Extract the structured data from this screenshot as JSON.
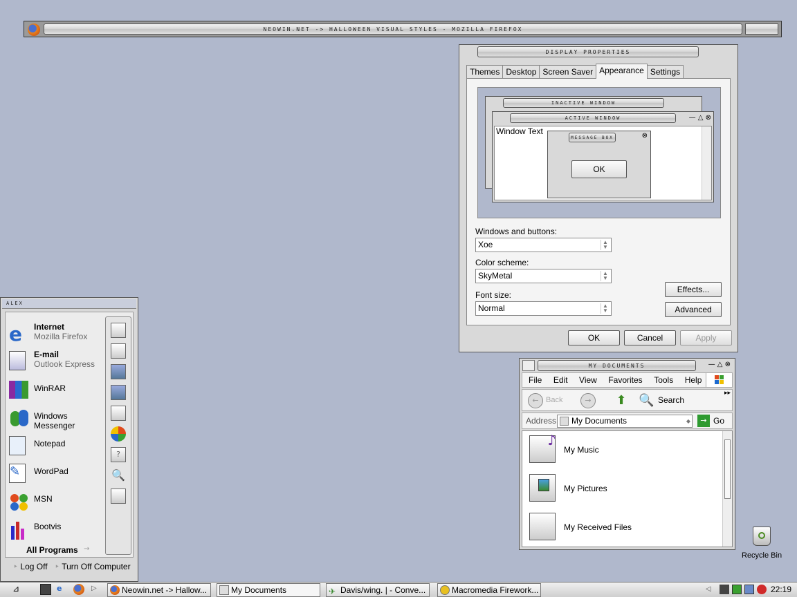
{
  "firefox_window": {
    "title": "NEOWIN.NET -> HALLOWEEN VISUAL STYLES - MOZILLA FIREFOX"
  },
  "display_properties": {
    "title": "DISPLAY PROPERTIES",
    "tabs": [
      "Themes",
      "Desktop",
      "Screen Saver",
      "Appearance",
      "Settings"
    ],
    "active_tab": "Appearance",
    "preview": {
      "inactive_title": "INACTIVE WINDOW",
      "active_title": "ACTIVE WINDOW",
      "window_text": "Window Text",
      "message_box_title": "MESSAGE BOX",
      "ok_label": "OK"
    },
    "windows_buttons_label": "Windows and buttons:",
    "windows_buttons_value": "Xoe",
    "color_scheme_label": "Color scheme:",
    "color_scheme_value": "SkyMetal",
    "font_size_label": "Font size:",
    "font_size_value": "Normal",
    "effects_label": "Effects...",
    "advanced_label": "Advanced",
    "ok_label": "OK",
    "cancel_label": "Cancel",
    "apply_label": "Apply"
  },
  "my_documents": {
    "title": "MY DOCUMENTS",
    "menu": [
      "File",
      "Edit",
      "View",
      "Favorites",
      "Tools",
      "Help"
    ],
    "back_label": "Back",
    "search_label": "Search",
    "address_label": "Address",
    "address_value": "My Documents",
    "go_label": "Go",
    "items": [
      "My Music",
      "My Pictures",
      "My Received Files"
    ]
  },
  "start_menu": {
    "user": "ALEX",
    "items": [
      {
        "name": "Internet",
        "sub": "Mozilla Firefox"
      },
      {
        "name": "E-mail",
        "sub": "Outlook Express"
      },
      {
        "name": "WinRAR"
      },
      {
        "name": "Windows Messenger"
      },
      {
        "name": "Notepad"
      },
      {
        "name": "WordPad"
      },
      {
        "name": "MSN"
      },
      {
        "name": "Bootvis"
      }
    ],
    "all_programs": "All Programs",
    "log_off": "Log Off",
    "turn_off": "Turn Off Computer"
  },
  "desktop": {
    "recycle_bin": "Recycle Bin"
  },
  "taskbar": {
    "buttons": [
      "Neowin.net -> Hallow...",
      "My Documents",
      "Davis/wing. | - Conve...",
      "Macromedia Firework..."
    ],
    "clock": "22:19"
  }
}
